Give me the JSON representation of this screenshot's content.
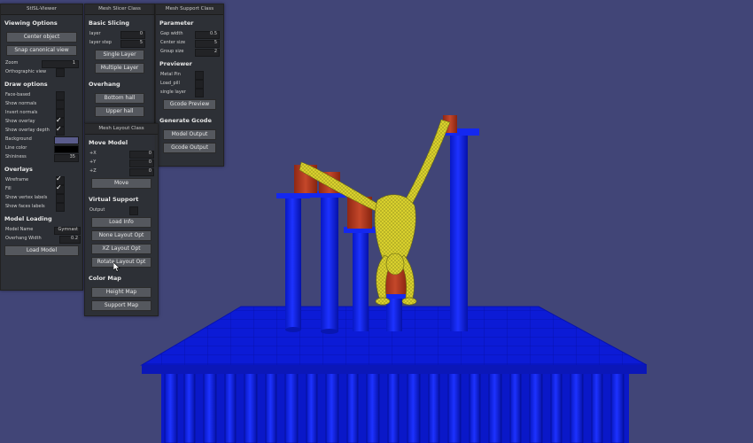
{
  "stl_viewer": {
    "title": "StlSL-Viewer",
    "viewing_options": "Viewing Options",
    "center_object": "Center object",
    "snap_canonical": "Snap canonical view",
    "zoom_label": "Zoom",
    "zoom_value": "1",
    "orthographic_label": "Orthographic view",
    "draw_options": "Draw options",
    "face_based": "Face-based",
    "show_normals": "Show normals",
    "invert_normals": "Invert normals",
    "show_overlay": "Show overlay",
    "show_overlay_depth": "Show overlay depth",
    "background_label": "Background",
    "line_color_label": "Line color",
    "shininess_label": "Shininess",
    "shininess_value": "35",
    "overlays": "Overlays",
    "wireframe": "Wireframe",
    "fill": "Fill",
    "show_vertex_labels": "Show vertex labels",
    "show_faces_labels": "Show faces labels",
    "model_loading": "Model Loading",
    "model_name_label": "Model Name",
    "model_name_value": "Gymnast",
    "overhang_width_label": "Overhang Width",
    "overhang_width_value": "0.2",
    "load_model": "Load Model"
  },
  "mesh_slicer": {
    "title": "Mesh Slicer Class",
    "basic_slicing": "Basic Slicing",
    "layer_label": "layer",
    "layer_value": "0",
    "layer_step_label": "layer step",
    "layer_step_value": "5",
    "single_layer": "Single Layer",
    "multiple_layer": "Multiple Layer",
    "overhang": "Overhang",
    "bottom_hall": "Bottom hall",
    "upper_hall": "Upper hall"
  },
  "mesh_support": {
    "title": "Mesh Support Class",
    "parameter": "Parameter",
    "gap_width_label": "Gap width",
    "gap_width_value": "0.5",
    "center_size_label": "Center size",
    "center_size_value": "5",
    "group_size_label": "Group size",
    "group_size_value": "2",
    "previewer": "Previewer",
    "metal_pin": "Metal Pin",
    "load_pill": "Load_pill",
    "single_layer": "single layer",
    "gcode_preview": "Gcode Preview",
    "generate_gcode": "Generate Gcode",
    "model_output": "Model Output",
    "gcode_output": "Gcode Output"
  },
  "mesh_layout": {
    "title": "Mesh Layout Class",
    "move_model": "Move Model",
    "x_label": "+X",
    "x_value": "0",
    "y_label": "+Y",
    "y_value": "0",
    "z_label": "+Z",
    "z_value": "0",
    "move": "Move",
    "virtual_support": "Virtual Support",
    "output_label": "Output",
    "load_info": "Load Info",
    "none_layout_opt": "None Layout Opt",
    "xz_layout_opt": "XZ Layout Opt",
    "rotate_layout_opt": "Rotate Layout Opt",
    "color_map": "Color Map",
    "height_map": "Height Map",
    "support_map": "Support Map"
  },
  "colors": {
    "background": "#414577",
    "support_blue": "#0a1ee6",
    "model_yellow": "#d8cf2e",
    "pin_red": "#b83a22",
    "panel": "#2c2e32",
    "button": "#55585e",
    "background_swatch": "#5a5c8c",
    "line_color_swatch": "#000000"
  }
}
